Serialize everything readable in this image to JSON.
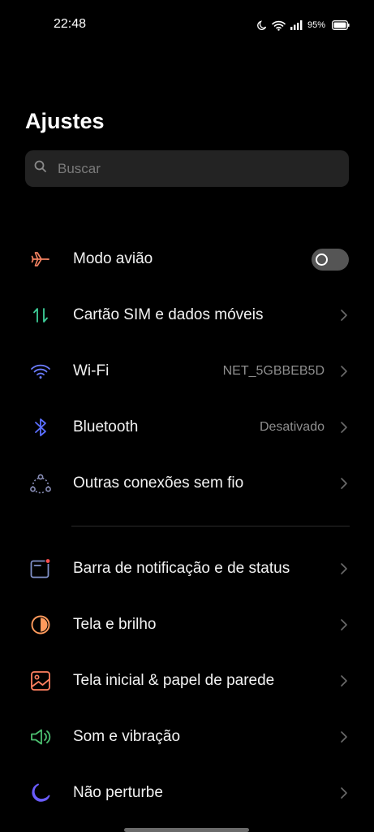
{
  "status_bar": {
    "time": "22:48",
    "battery": "95%",
    "icons": [
      "moon-icon",
      "wifi-icon",
      "signal-icon",
      "battery-icon"
    ]
  },
  "title": "Ajustes",
  "search": {
    "placeholder": "Buscar"
  },
  "settings": {
    "airplane": {
      "label": "Modo avião",
      "icon": "airplane-icon",
      "toggle_on": false,
      "color": "#f08060"
    },
    "sim": {
      "label": "Cartão SIM e dados móveis",
      "icon": "mobile-data-icon",
      "color": "#3ecf9a"
    },
    "wifi": {
      "label": "Wi-Fi",
      "value": "NET_5GBBEB5D",
      "icon": "wifi-icon",
      "color": "#6b7cff"
    },
    "bluetooth": {
      "label": "Bluetooth",
      "value": "Desativado",
      "icon": "bluetooth-icon",
      "color": "#5b6fff"
    },
    "other": {
      "label": "Outras conexões sem fio",
      "icon": "connections-icon",
      "color": "#8a8fb8"
    },
    "notifications": {
      "label": "Barra de notificação e de status",
      "icon": "notification-bar-icon",
      "color": "#8090c8"
    },
    "display": {
      "label": "Tela e brilho",
      "icon": "brightness-icon",
      "color": "#ff9a5c"
    },
    "home": {
      "label": "Tela inicial & papel de parede",
      "icon": "wallpaper-icon",
      "color": "#ff8060"
    },
    "sound": {
      "label": "Som e vibração",
      "icon": "speaker-icon",
      "color": "#4cc070"
    },
    "dnd": {
      "label": "Não perturbe",
      "icon": "moon-icon",
      "color": "#6a5cff"
    }
  }
}
